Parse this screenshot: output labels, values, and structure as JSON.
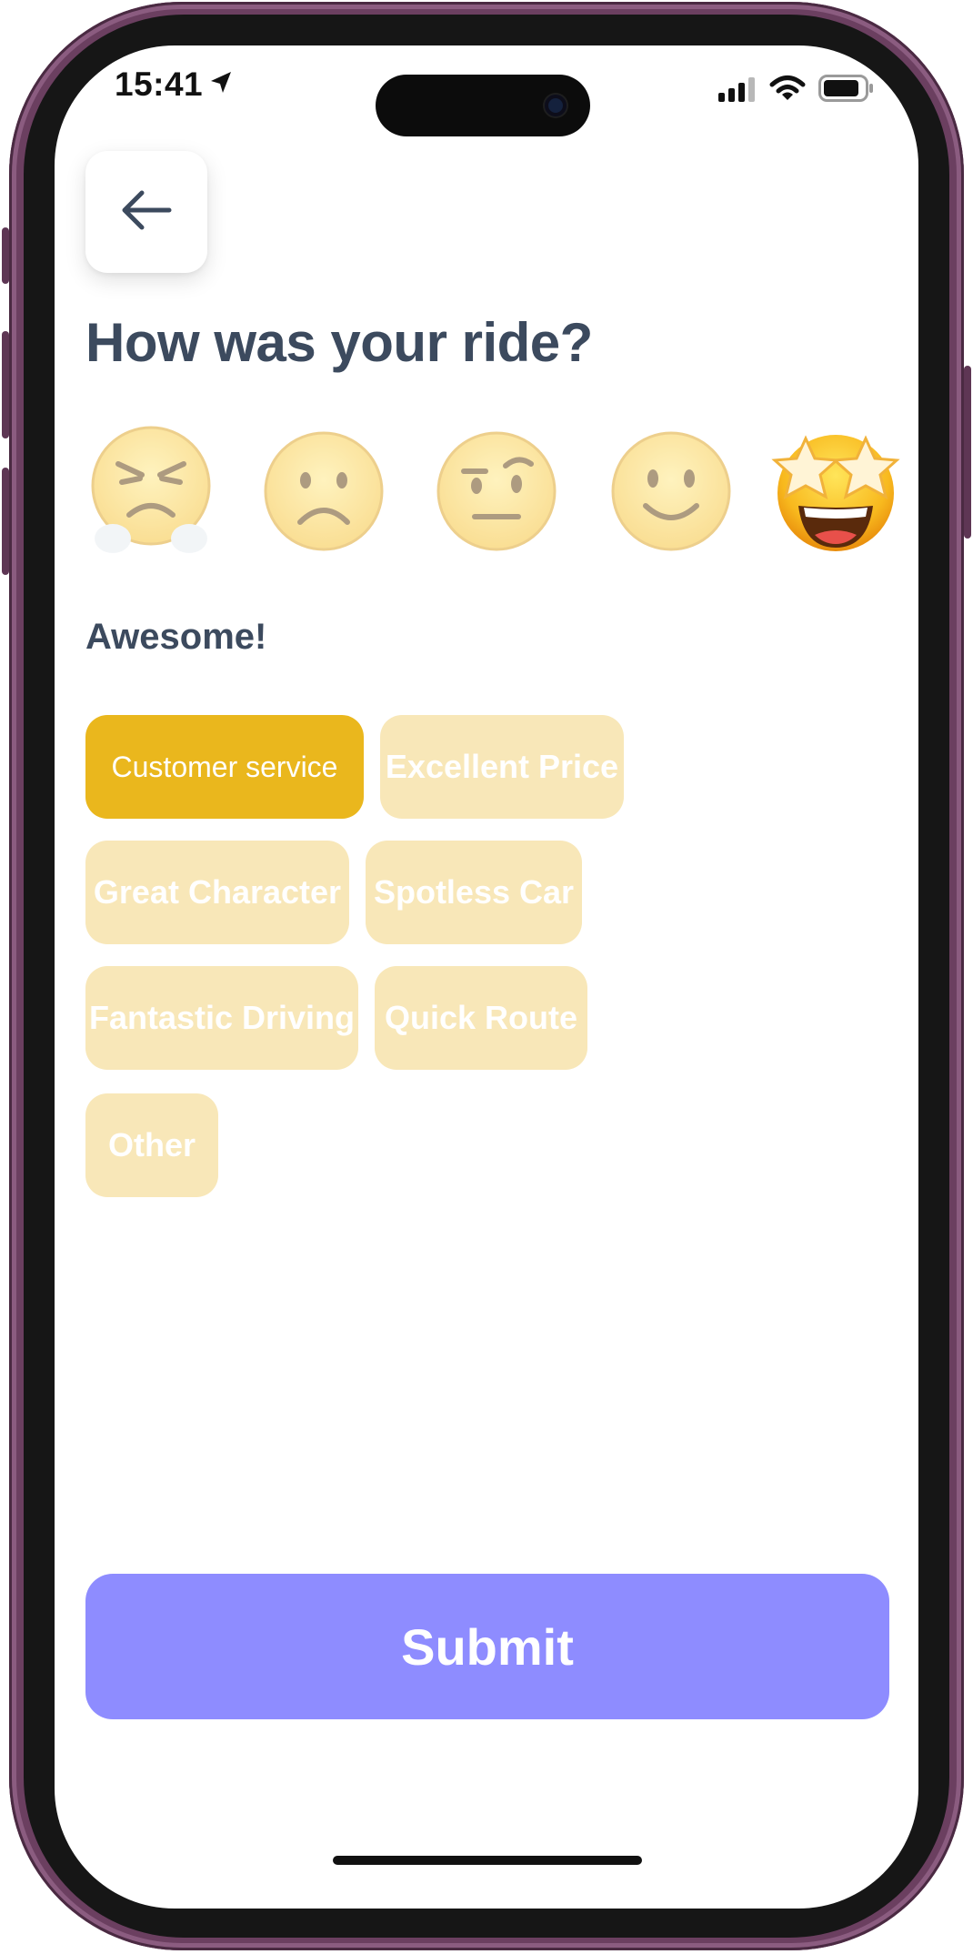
{
  "status_bar": {
    "time": "15:41",
    "location_icon": "location-arrow-icon",
    "signal_icon": "cellular-signal-icon",
    "wifi_icon": "wifi-icon",
    "battery_icon": "battery-icon"
  },
  "header": {
    "back_icon": "arrow-left-icon",
    "title": "How was your ride?"
  },
  "rating": {
    "options": [
      {
        "icon": "angry-face-icon"
      },
      {
        "icon": "frowning-face-icon"
      },
      {
        "icon": "raised-eyebrow-face-icon"
      },
      {
        "icon": "slightly-smiling-face-icon"
      },
      {
        "icon": "star-struck-face-icon"
      }
    ],
    "selected_index": 4,
    "label": "Awesome!"
  },
  "tags": [
    {
      "label": "Customer service",
      "selected": true
    },
    {
      "label": "Excellent Price",
      "selected": false
    },
    {
      "label": "Great Character",
      "selected": false
    },
    {
      "label": "Spotless Car",
      "selected": false
    },
    {
      "label": "Fantastic Driving",
      "selected": false
    },
    {
      "label": "Quick Route",
      "selected": false
    },
    {
      "label": "Other",
      "selected": false
    }
  ],
  "submit": {
    "label": "Submit"
  },
  "colors": {
    "title": "#3c4a5e",
    "chip_selected": "#eab71d",
    "chip_unselected": "#f8e7b8",
    "submit": "#8e8cff",
    "phone_frame": "#6b3f60"
  }
}
